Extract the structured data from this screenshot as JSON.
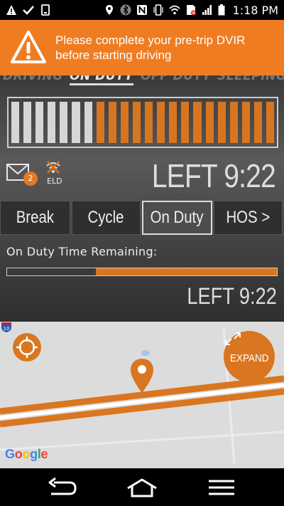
{
  "status_bar": {
    "time": "1:18 PM",
    "icons_left": [
      "warning-icon",
      "check-icon",
      "phone-icon"
    ],
    "icons_right": [
      "location-icon",
      "bluetooth-icon",
      "nfc-icon",
      "vibrate-icon",
      "wifi-icon",
      "sim-icon",
      "signal-icon",
      "battery-icon"
    ]
  },
  "alert": {
    "message": "Please complete your pre-trip DVIR before starting driving",
    "icon": "warning-icon",
    "color": "#f07c22"
  },
  "duty_status_tabs": [
    {
      "label": "DRIVING",
      "active": false
    },
    {
      "label": "ON DUTY",
      "active": true
    },
    {
      "label": "OFF DUTY",
      "active": false
    },
    {
      "label": "SLEEPING",
      "active": false
    }
  ],
  "time_bar": {
    "total_segments": 22,
    "used_segments": 7,
    "used_color": "#d6d6d6",
    "remaining_color": "#d8761f"
  },
  "messages": {
    "icon": "mail-icon",
    "count": "2"
  },
  "eld": {
    "icon": "eld-disconnected-icon",
    "label": "ELD"
  },
  "main_time": {
    "text": "LEFT 9:22"
  },
  "clock_tabs": [
    {
      "label": "Break",
      "active": false
    },
    {
      "label": "Cycle",
      "active": false
    },
    {
      "label": "On Duty",
      "active": true
    },
    {
      "label": "HOS >",
      "active": false
    }
  ],
  "on_duty": {
    "label": "On Duty Time Remaining:",
    "used_fraction": 0.33,
    "time_text": "LEFT 9:22"
  },
  "map": {
    "expand_label": "EXPAND",
    "provider": "Google",
    "highway_shield": "10",
    "accent": "#d9761f"
  },
  "nav": {
    "back_icon": "back-icon",
    "home_icon": "home-icon",
    "menu_icon": "menu-icon"
  }
}
